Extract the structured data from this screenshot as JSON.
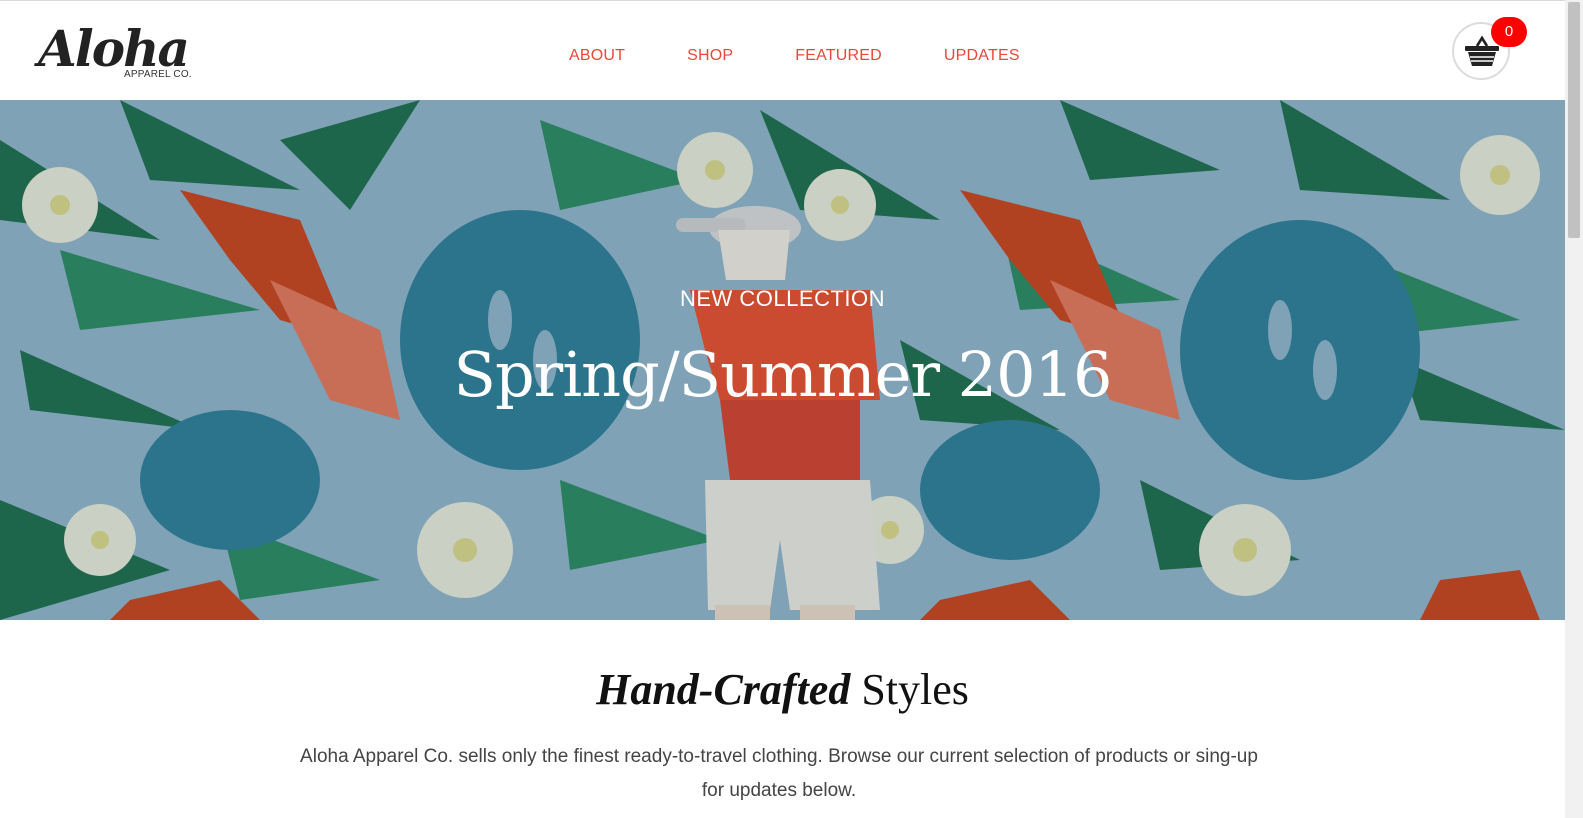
{
  "header": {
    "logo_script": "Aloha",
    "logo_sub": "APPAREL CO.",
    "nav": [
      {
        "label": "ABOUT"
      },
      {
        "label": "SHOP"
      },
      {
        "label": "FEATURED"
      },
      {
        "label": "UPDATES"
      }
    ],
    "cart_count": "0"
  },
  "hero": {
    "kicker": "NEW COLLECTION",
    "title": "Spring/Summer 2016"
  },
  "intro": {
    "title_italic": "Hand-Crafted",
    "title_rest": " Styles",
    "text": "Aloha Apparel Co. sells only the finest ready-to-travel clothing. Browse our current selection of products or sing-up for updates below."
  },
  "colors": {
    "accent": "#e9473a",
    "badge": "#ff0000",
    "hero_bg": "#8fb3c8"
  },
  "icons": {
    "cart": "shopping-basket-icon"
  }
}
